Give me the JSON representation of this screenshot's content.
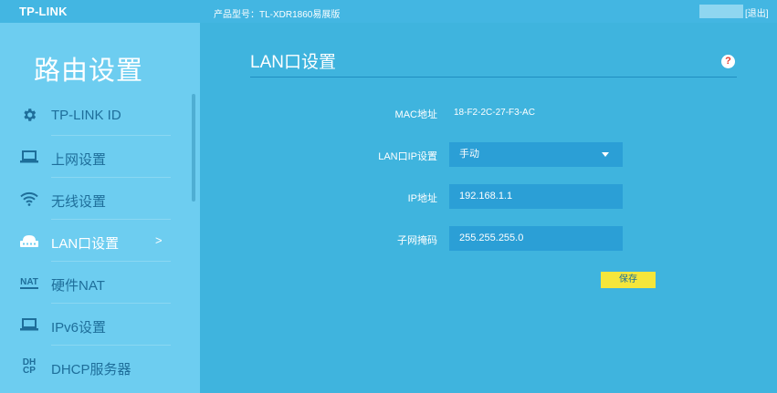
{
  "header": {
    "logo": "TP-LINK",
    "model": "产品型号：TL-XDR1860易展版",
    "logout": "[退出]"
  },
  "sidebar": {
    "title": "路由设置",
    "items": [
      {
        "label": "TP-LINK ID",
        "icon": "gear-icon"
      },
      {
        "label": "上网设置",
        "icon": "laptop-icon"
      },
      {
        "label": "无线设置",
        "icon": "wifi-icon"
      },
      {
        "label": "LAN口设置",
        "icon": "router-icon",
        "active": true,
        "chevron": ">"
      },
      {
        "label": "硬件NAT",
        "icon": "nat-icon",
        "icon_text": "NAT"
      },
      {
        "label": "IPv6设置",
        "icon": "laptop-icon"
      },
      {
        "label": "DHCP服务器",
        "icon": "dhcp-icon",
        "icon_text": "DH\nCP"
      }
    ]
  },
  "main": {
    "title": "LAN口设置",
    "help": "?",
    "mac_label": "MAC地址",
    "mac_value": "18-F2-2C-27-F3-AC",
    "lan_ip_label": "LAN口IP设置",
    "lan_ip_value": "手动",
    "ip_label": "IP地址",
    "ip_value": "192.168.1.1",
    "mask_label": "子网掩码",
    "mask_value": "255.255.255.0",
    "save_label": "保存"
  },
  "colors": {
    "background": "#3fb4de",
    "sidebar": "#6dcdf0",
    "field": "#2b9fd6",
    "save_button": "#f5e63b",
    "help_icon": "#e53b2c"
  }
}
